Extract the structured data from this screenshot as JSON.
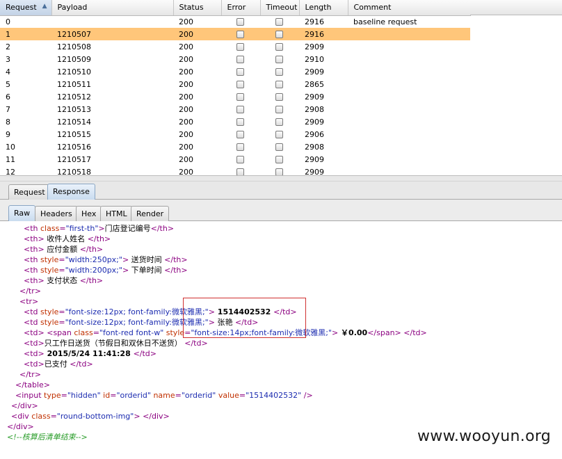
{
  "results": {
    "columns": {
      "request": "Request",
      "payload": "Payload",
      "status": "Status",
      "error": "Error",
      "timeout": "Timeout",
      "length": "Length",
      "comment": "Comment"
    },
    "sort_indicator": "▲",
    "rows": [
      {
        "request": "0",
        "payload": "",
        "status": "200",
        "length": "2916",
        "comment": "baseline request"
      },
      {
        "request": "1",
        "payload": "1210507",
        "status": "200",
        "length": "2916",
        "comment": ""
      },
      {
        "request": "2",
        "payload": "1210508",
        "status": "200",
        "length": "2909",
        "comment": ""
      },
      {
        "request": "3",
        "payload": "1210509",
        "status": "200",
        "length": "2910",
        "comment": ""
      },
      {
        "request": "4",
        "payload": "1210510",
        "status": "200",
        "length": "2909",
        "comment": ""
      },
      {
        "request": "5",
        "payload": "1210511",
        "status": "200",
        "length": "2865",
        "comment": ""
      },
      {
        "request": "6",
        "payload": "1210512",
        "status": "200",
        "length": "2909",
        "comment": ""
      },
      {
        "request": "7",
        "payload": "1210513",
        "status": "200",
        "length": "2908",
        "comment": ""
      },
      {
        "request": "8",
        "payload": "1210514",
        "status": "200",
        "length": "2909",
        "comment": ""
      },
      {
        "request": "9",
        "payload": "1210515",
        "status": "200",
        "length": "2906",
        "comment": ""
      },
      {
        "request": "10",
        "payload": "1210516",
        "status": "200",
        "length": "2908",
        "comment": ""
      },
      {
        "request": "11",
        "payload": "1210517",
        "status": "200",
        "length": "2909",
        "comment": ""
      },
      {
        "request": "12",
        "payload": "1210518",
        "status": "200",
        "length": "2909",
        "comment": ""
      }
    ],
    "selected_row": "1"
  },
  "tabs": {
    "top": [
      "Request",
      "Response"
    ],
    "top_active": "Response",
    "sub": [
      "Raw",
      "Headers",
      "Hex",
      "HTML",
      "Render"
    ],
    "sub_active": "Raw"
  },
  "raw_lines": [
    {
      "indent": 34,
      "parts": [
        [
          "tag",
          "<th "
        ],
        [
          "attr",
          "class"
        ],
        [
          "tag",
          "="
        ],
        [
          "val",
          "\"first-th\""
        ],
        [
          "tag",
          ">"
        ],
        [
          "txt",
          "门店登记编号"
        ],
        [
          "tag",
          "</th>"
        ]
      ]
    },
    {
      "indent": 34,
      "parts": [
        [
          "tag",
          "<th>"
        ],
        [
          "txt",
          " 收件人姓名 "
        ],
        [
          "tag",
          "</th>"
        ]
      ]
    },
    {
      "indent": 34,
      "parts": [
        [
          "tag",
          "<th>"
        ],
        [
          "txt",
          " 应付金额 "
        ],
        [
          "tag",
          "</th>"
        ]
      ]
    },
    {
      "indent": 34,
      "parts": [
        [
          "tag",
          "<th "
        ],
        [
          "attr",
          "style"
        ],
        [
          "tag",
          "="
        ],
        [
          "val",
          "\"width:250px;\""
        ],
        [
          "tag",
          ">"
        ],
        [
          "txt",
          " 送货时间 "
        ],
        [
          "tag",
          "</th>"
        ]
      ]
    },
    {
      "indent": 34,
      "parts": [
        [
          "tag",
          "<th "
        ],
        [
          "attr",
          "style"
        ],
        [
          "tag",
          "="
        ],
        [
          "val",
          "\"width:200px;\""
        ],
        [
          "tag",
          ">"
        ],
        [
          "txt",
          " 下单时间 "
        ],
        [
          "tag",
          "</th>"
        ]
      ]
    },
    {
      "indent": 34,
      "parts": [
        [
          "tag",
          "<th>"
        ],
        [
          "txt",
          " 支付状态 "
        ],
        [
          "tag",
          "</th>"
        ]
      ]
    },
    {
      "indent": 28,
      "parts": [
        [
          "tag",
          "</tr>"
        ]
      ]
    },
    {
      "indent": 28,
      "parts": [
        [
          "tag",
          "<tr>"
        ]
      ]
    },
    {
      "indent": 34,
      "parts": [
        [
          "tag",
          "<td "
        ],
        [
          "attr",
          "style"
        ],
        [
          "tag",
          "="
        ],
        [
          "val",
          "\"font-size:12px; font-family:微软雅黑;\""
        ],
        [
          "tag",
          ">"
        ],
        [
          "bold",
          " 1514402532 "
        ],
        [
          "tag",
          "</td>"
        ]
      ]
    },
    {
      "indent": 34,
      "parts": [
        [
          "tag",
          "<td "
        ],
        [
          "attr",
          "style"
        ],
        [
          "tag",
          "="
        ],
        [
          "val",
          "\"font-size:12px; font-family:微软雅黑;\""
        ],
        [
          "tag",
          ">"
        ],
        [
          "txt",
          " 张艳 "
        ],
        [
          "tag",
          "</td>"
        ]
      ]
    },
    {
      "indent": 34,
      "parts": [
        [
          "tag",
          "<td>"
        ],
        [
          "txt",
          " "
        ],
        [
          "tag",
          "<span "
        ],
        [
          "attr",
          "class"
        ],
        [
          "tag",
          "="
        ],
        [
          "val",
          "\"font-red font-w\""
        ],
        [
          "txt",
          " "
        ],
        [
          "attr",
          "style"
        ],
        [
          "tag",
          "="
        ],
        [
          "val",
          "\"font-size:14px;font-family:微软雅黑;\""
        ],
        [
          "tag",
          ">"
        ],
        [
          "bold",
          " ￥0.00"
        ],
        [
          "tag",
          "</span>"
        ],
        [
          "txt",
          " "
        ],
        [
          "tag",
          "</td>"
        ]
      ]
    },
    {
      "indent": 34,
      "parts": [
        [
          "tag",
          "<td>"
        ],
        [
          "txt",
          "只工作日送货（节假日和双休日不送货） "
        ],
        [
          "tag",
          "</td>"
        ]
      ]
    },
    {
      "indent": 34,
      "parts": [
        [
          "tag",
          "<td>"
        ],
        [
          "bold",
          " 2015/5/24 11:41:28 "
        ],
        [
          "tag",
          "</td>"
        ]
      ]
    },
    {
      "indent": 34,
      "parts": [
        [
          "tag",
          "<td>"
        ],
        [
          "txt",
          "已支付 "
        ],
        [
          "tag",
          "</td>"
        ]
      ]
    },
    {
      "indent": 28,
      "parts": [
        [
          "tag",
          "</tr>"
        ]
      ]
    },
    {
      "indent": 22,
      "parts": [
        [
          "tag",
          "</table>"
        ]
      ]
    },
    {
      "indent": 22,
      "parts": [
        [
          "tag",
          "<input "
        ],
        [
          "attr",
          "type"
        ],
        [
          "tag",
          "="
        ],
        [
          "val",
          "\"hidden\""
        ],
        [
          "txt",
          " "
        ],
        [
          "attr",
          "id"
        ],
        [
          "tag",
          "="
        ],
        [
          "val",
          "\"orderid\""
        ],
        [
          "txt",
          " "
        ],
        [
          "attr",
          "name"
        ],
        [
          "tag",
          "="
        ],
        [
          "val",
          "\"orderid\""
        ],
        [
          "txt",
          " "
        ],
        [
          "attr",
          "value"
        ],
        [
          "tag",
          "="
        ],
        [
          "val",
          "\"1514402532\""
        ],
        [
          "txt",
          " "
        ],
        [
          "tag",
          "/>"
        ]
      ]
    },
    {
      "indent": 16,
      "parts": [
        [
          "tag",
          "</div>"
        ]
      ]
    },
    {
      "indent": 16,
      "parts": [
        [
          "tag",
          "<div "
        ],
        [
          "attr",
          "class"
        ],
        [
          "tag",
          "="
        ],
        [
          "val",
          "\"round-bottom-img\""
        ],
        [
          "tag",
          ">"
        ],
        [
          "txt",
          " "
        ],
        [
          "tag",
          "</div>"
        ]
      ]
    },
    {
      "indent": 10,
      "parts": [
        [
          "tag",
          "</div>"
        ]
      ]
    },
    {
      "indent": 10,
      "parts": [
        [
          "comment",
          "<!--核算后清单结束-->"
        ]
      ]
    }
  ],
  "watermark": "www.wooyun.org"
}
